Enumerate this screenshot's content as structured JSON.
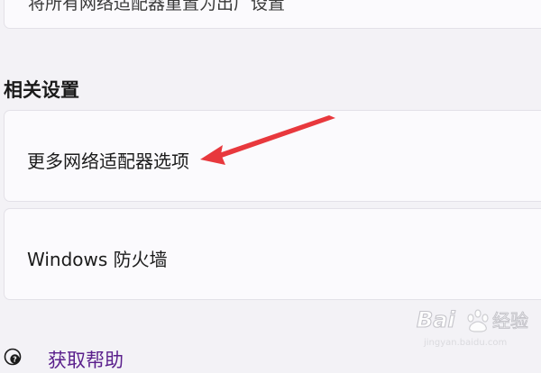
{
  "top_card": {
    "label": "将所有网络适配器重置为出厂设置"
  },
  "related_settings": {
    "heading": "相关设置",
    "items": [
      {
        "label": "更多网络适配器选项"
      },
      {
        "label": "Windows 防火墙"
      }
    ]
  },
  "help": {
    "label": "获取帮助",
    "icon": "help-icon"
  },
  "annotation": {
    "color": "#e8383d"
  },
  "watermark": {
    "text": "Baidu 经验",
    "subtext": "jingyan.baidu.com"
  }
}
